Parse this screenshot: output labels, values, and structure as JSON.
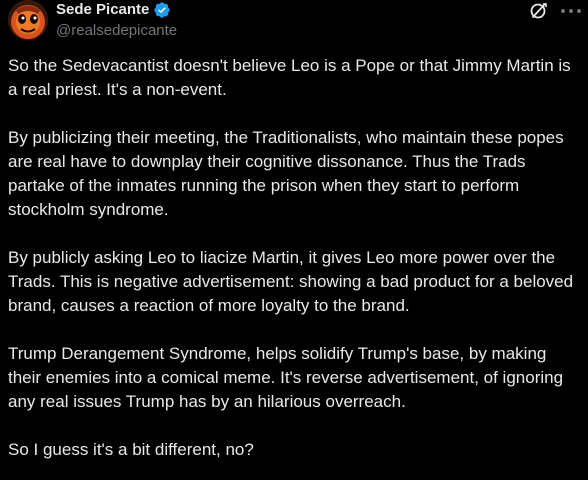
{
  "author": {
    "display_name": "Sede Picante",
    "handle": "@realsedepicante",
    "verified_icon": "verified-badge-icon",
    "avatar_icon": "avatar-image"
  },
  "actions": {
    "grok_icon": "grok-icon",
    "more_icon": "more-options-icon"
  },
  "tweet": {
    "paragraphs": [
      "So the Sedevacantist doesn't believe Leo is a Pope or that Jimmy Martin is a real priest. It's a non-event.",
      "By publicizing their meeting, the Traditionalists, who maintain these popes are real have to downplay their cognitive dissonance. Thus the Trads partake of the inmates running the prison when they start to perform stockholm syndrome.",
      "By publicly asking Leo to liacize Martin, it gives Leo more power over the Trads. This is negative advertisement: showing a bad product for a beloved brand, causes a reaction of more loyalty to the brand.",
      "Trump Derangement Syndrome, helps solidify Trump's base, by making their enemies into a comical meme. It's reverse advertisement, of ignoring any real issues Trump has by an hilarious overreach.",
      "So I guess it's a bit different, no?"
    ]
  },
  "colors": {
    "background": "#000000",
    "text": "#e7e9ea",
    "secondary": "#71767b",
    "verified": "#1d9bf0"
  }
}
